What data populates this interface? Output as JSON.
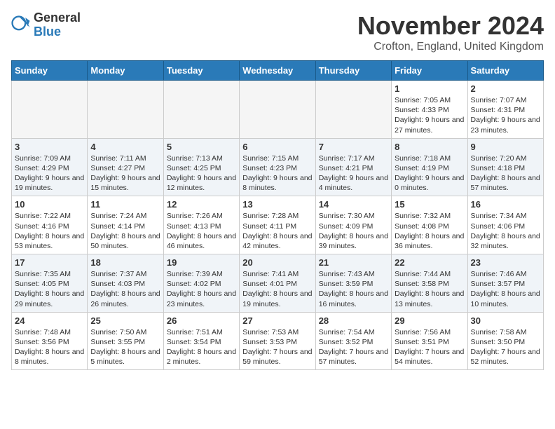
{
  "header": {
    "logo_general": "General",
    "logo_blue": "Blue",
    "month_title": "November 2024",
    "location": "Crofton, England, United Kingdom"
  },
  "days_of_week": [
    "Sunday",
    "Monday",
    "Tuesday",
    "Wednesday",
    "Thursday",
    "Friday",
    "Saturday"
  ],
  "weeks": [
    [
      {
        "day": "",
        "info": ""
      },
      {
        "day": "",
        "info": ""
      },
      {
        "day": "",
        "info": ""
      },
      {
        "day": "",
        "info": ""
      },
      {
        "day": "",
        "info": ""
      },
      {
        "day": "1",
        "info": "Sunrise: 7:05 AM\nSunset: 4:33 PM\nDaylight: 9 hours and 27 minutes."
      },
      {
        "day": "2",
        "info": "Sunrise: 7:07 AM\nSunset: 4:31 PM\nDaylight: 9 hours and 23 minutes."
      }
    ],
    [
      {
        "day": "3",
        "info": "Sunrise: 7:09 AM\nSunset: 4:29 PM\nDaylight: 9 hours and 19 minutes."
      },
      {
        "day": "4",
        "info": "Sunrise: 7:11 AM\nSunset: 4:27 PM\nDaylight: 9 hours and 15 minutes."
      },
      {
        "day": "5",
        "info": "Sunrise: 7:13 AM\nSunset: 4:25 PM\nDaylight: 9 hours and 12 minutes."
      },
      {
        "day": "6",
        "info": "Sunrise: 7:15 AM\nSunset: 4:23 PM\nDaylight: 9 hours and 8 minutes."
      },
      {
        "day": "7",
        "info": "Sunrise: 7:17 AM\nSunset: 4:21 PM\nDaylight: 9 hours and 4 minutes."
      },
      {
        "day": "8",
        "info": "Sunrise: 7:18 AM\nSunset: 4:19 PM\nDaylight: 9 hours and 0 minutes."
      },
      {
        "day": "9",
        "info": "Sunrise: 7:20 AM\nSunset: 4:18 PM\nDaylight: 8 hours and 57 minutes."
      }
    ],
    [
      {
        "day": "10",
        "info": "Sunrise: 7:22 AM\nSunset: 4:16 PM\nDaylight: 8 hours and 53 minutes."
      },
      {
        "day": "11",
        "info": "Sunrise: 7:24 AM\nSunset: 4:14 PM\nDaylight: 8 hours and 50 minutes."
      },
      {
        "day": "12",
        "info": "Sunrise: 7:26 AM\nSunset: 4:13 PM\nDaylight: 8 hours and 46 minutes."
      },
      {
        "day": "13",
        "info": "Sunrise: 7:28 AM\nSunset: 4:11 PM\nDaylight: 8 hours and 42 minutes."
      },
      {
        "day": "14",
        "info": "Sunrise: 7:30 AM\nSunset: 4:09 PM\nDaylight: 8 hours and 39 minutes."
      },
      {
        "day": "15",
        "info": "Sunrise: 7:32 AM\nSunset: 4:08 PM\nDaylight: 8 hours and 36 minutes."
      },
      {
        "day": "16",
        "info": "Sunrise: 7:34 AM\nSunset: 4:06 PM\nDaylight: 8 hours and 32 minutes."
      }
    ],
    [
      {
        "day": "17",
        "info": "Sunrise: 7:35 AM\nSunset: 4:05 PM\nDaylight: 8 hours and 29 minutes."
      },
      {
        "day": "18",
        "info": "Sunrise: 7:37 AM\nSunset: 4:03 PM\nDaylight: 8 hours and 26 minutes."
      },
      {
        "day": "19",
        "info": "Sunrise: 7:39 AM\nSunset: 4:02 PM\nDaylight: 8 hours and 23 minutes."
      },
      {
        "day": "20",
        "info": "Sunrise: 7:41 AM\nSunset: 4:01 PM\nDaylight: 8 hours and 19 minutes."
      },
      {
        "day": "21",
        "info": "Sunrise: 7:43 AM\nSunset: 3:59 PM\nDaylight: 8 hours and 16 minutes."
      },
      {
        "day": "22",
        "info": "Sunrise: 7:44 AM\nSunset: 3:58 PM\nDaylight: 8 hours and 13 minutes."
      },
      {
        "day": "23",
        "info": "Sunrise: 7:46 AM\nSunset: 3:57 PM\nDaylight: 8 hours and 10 minutes."
      }
    ],
    [
      {
        "day": "24",
        "info": "Sunrise: 7:48 AM\nSunset: 3:56 PM\nDaylight: 8 hours and 8 minutes."
      },
      {
        "day": "25",
        "info": "Sunrise: 7:50 AM\nSunset: 3:55 PM\nDaylight: 8 hours and 5 minutes."
      },
      {
        "day": "26",
        "info": "Sunrise: 7:51 AM\nSunset: 3:54 PM\nDaylight: 8 hours and 2 minutes."
      },
      {
        "day": "27",
        "info": "Sunrise: 7:53 AM\nSunset: 3:53 PM\nDaylight: 7 hours and 59 minutes."
      },
      {
        "day": "28",
        "info": "Sunrise: 7:54 AM\nSunset: 3:52 PM\nDaylight: 7 hours and 57 minutes."
      },
      {
        "day": "29",
        "info": "Sunrise: 7:56 AM\nSunset: 3:51 PM\nDaylight: 7 hours and 54 minutes."
      },
      {
        "day": "30",
        "info": "Sunrise: 7:58 AM\nSunset: 3:50 PM\nDaylight: 7 hours and 52 minutes."
      }
    ]
  ]
}
